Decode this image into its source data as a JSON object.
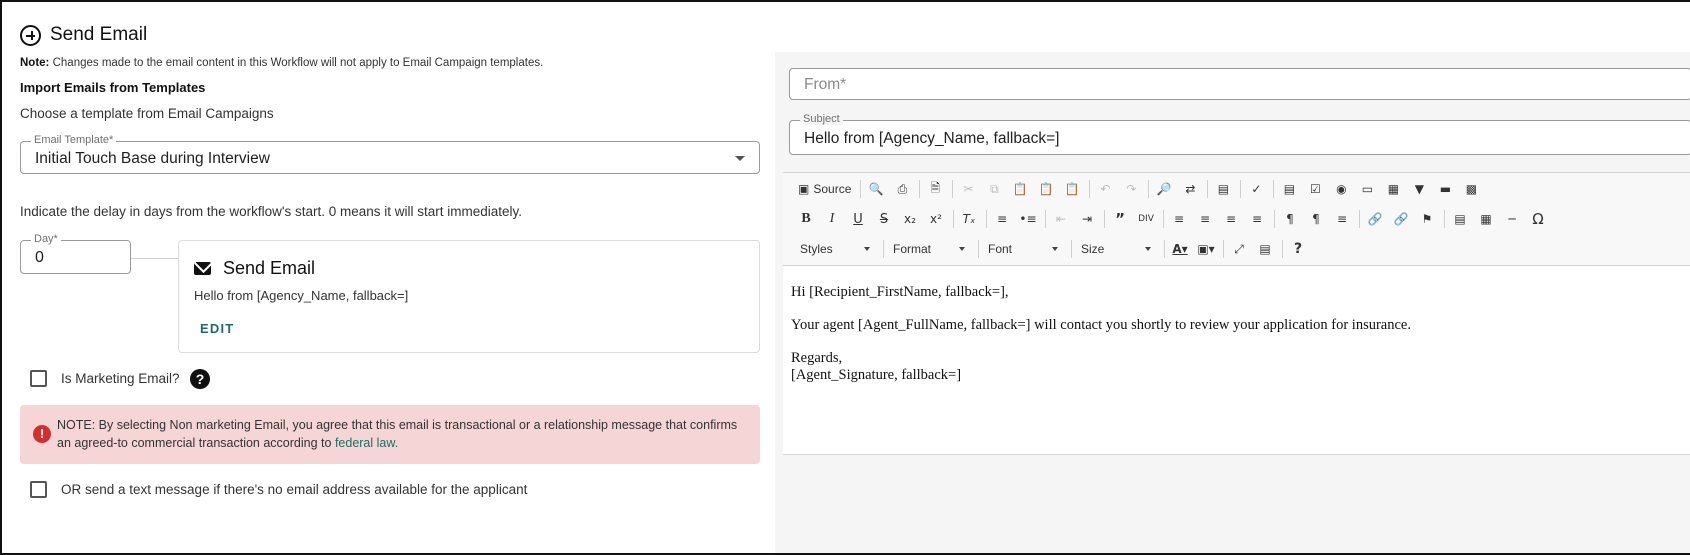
{
  "header": {
    "title": "Send Email"
  },
  "note": {
    "prefix": "Note:",
    "text": "Changes made to the email content in this Workflow will not apply to Email Campaign templates."
  },
  "import": {
    "heading": "Import Emails from Templates",
    "subtext": "Choose a template from Email Campaigns"
  },
  "template_field": {
    "label": "Email Template*",
    "value": "Initial Touch Base during Interview"
  },
  "delay": {
    "text": "Indicate the delay in days from the workflow's start. 0 means it will start immediately."
  },
  "day_field": {
    "label": "Day*",
    "value": "0"
  },
  "card": {
    "title": "Send Email",
    "subject": "Hello from [Agency_Name, fallback=]",
    "edit_label": "EDIT"
  },
  "marketing": {
    "label": "Is Marketing Email?",
    "checked": false
  },
  "alert": {
    "text": "NOTE: By selecting Non marketing Email, you agree that this email is transactional or a relationship message that confirms an agreed-to commercial transaction according to",
    "link": "federal law.",
    "color": "#f5d5d5"
  },
  "sms_option": {
    "label": "OR send a text message if there's no email address available for the applicant",
    "checked": false
  },
  "from_field": {
    "placeholder": "From*"
  },
  "subject_field": {
    "label": "Subject",
    "value": "Hello from [Agency_Name, fallback=]"
  },
  "toolbar": {
    "source_label": "Source",
    "styles": "Styles",
    "format": "Format",
    "font": "Font",
    "size": "Size"
  },
  "editor": {
    "greeting": "Hi [Recipient_FirstName, fallback=],",
    "body": "Your agent [Agent_FullName, fallback=] will contact you shortly to review your application for insurance.",
    "closing": "Regards,",
    "signature": "[Agent_Signature, fallback=]"
  },
  "colors": {
    "accent": "#1f6e65",
    "error": "#d32f2f"
  }
}
